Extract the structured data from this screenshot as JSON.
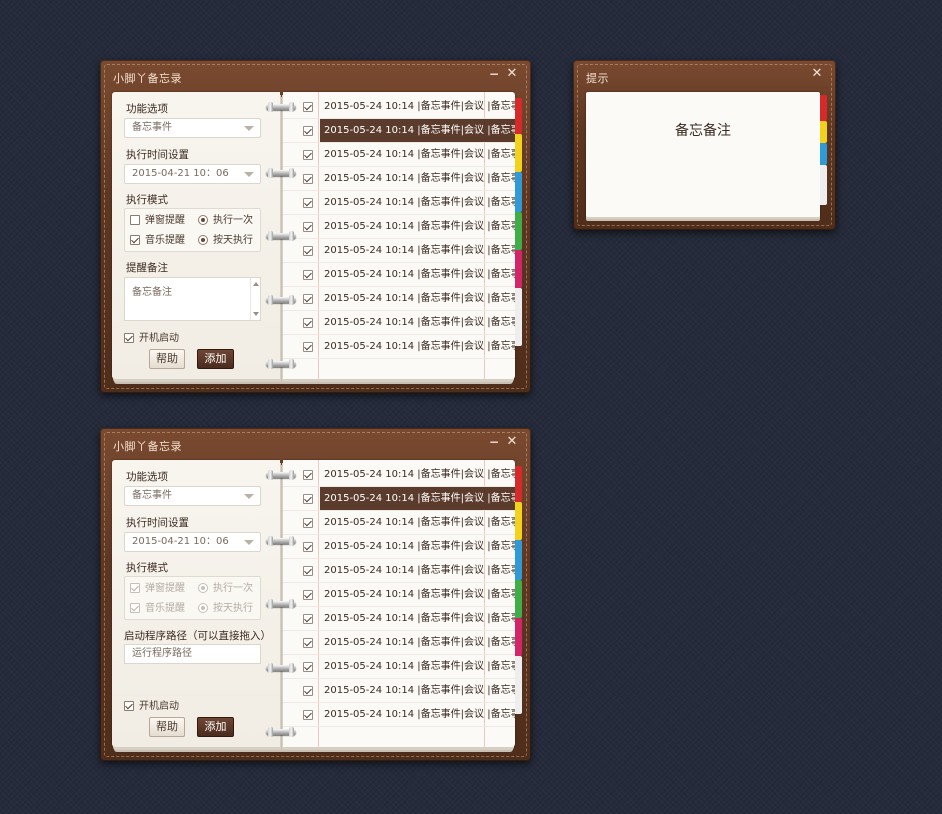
{
  "colors": {
    "background": "#252b3b",
    "leather": "#5e3722",
    "page": "#fbfaf6",
    "selected_row": "#5b3b2b",
    "tabs": [
      "#d62a2a",
      "#f2d21a",
      "#2e9bd6",
      "#3fae49",
      "#d4246a",
      "#eeeeee"
    ]
  },
  "icons": {
    "minimize": "minimize-icon",
    "close": "close-icon",
    "dropdown_arrow": "chevron-down-icon"
  },
  "window1": {
    "title": "小脚丫备忘录",
    "minimize": "−",
    "close": "✕",
    "function_label": "功能选项",
    "function_value": "备忘事件",
    "time_label": "执行时间设置",
    "time_value": "2015-04-21  10：06",
    "mode_label": "执行模式",
    "opt_popup": "弹窗提醒",
    "opt_once": "执行一次",
    "opt_music": "音乐提醒",
    "opt_daily": "按天执行",
    "note_label": "提醒备注",
    "note_value": "备忘备注",
    "startup_label": "开机启动",
    "help_button": "帮助",
    "add_button": "添加"
  },
  "window2": {
    "title": "小脚丫备忘录",
    "minimize": "−",
    "close": "✕",
    "function_label": "功能选项",
    "function_value": "备忘事件",
    "time_label": "执行时间设置",
    "time_value": "2015-04-21  10：06",
    "mode_label": "执行模式",
    "opt_popup": "弹窗提醒",
    "opt_once": "执行一次",
    "opt_music": "音乐提醒",
    "opt_daily": "按天执行",
    "path_label": "启动程序路径（可以直接拖入）",
    "path_placeholder": "运行程序路径",
    "startup_label": "开机启动",
    "help_button": "帮助",
    "add_button": "添加"
  },
  "tip": {
    "title": "提示",
    "close": "✕",
    "message": "备忘备注"
  },
  "list": [
    "2015-05-24 10:14 |备忘事件|会议 |备忘事",
    "2015-05-24 10:14 |备忘事件|会议 |备忘事",
    "2015-05-24 10:14 |备忘事件|会议 |备忘事",
    "2015-05-24 10:14 |备忘事件|会议 |备忘事",
    "2015-05-24 10:14 |备忘事件|会议 |备忘事",
    "2015-05-24 10:14 |备忘事件|会议 |备忘事",
    "2015-05-24 10:14 |备忘事件|会议 |备忘事",
    "2015-05-24 10:14 |备忘事件|会议 |备忘事",
    "2015-05-24 10:14 |备忘事件|会议 |备忘事",
    "2015-05-24 10:14 |备忘事件|会议 |备忘事",
    "2015-05-24 10:14 |备忘事件|会议 |备忘事"
  ],
  "selected_index": 1
}
